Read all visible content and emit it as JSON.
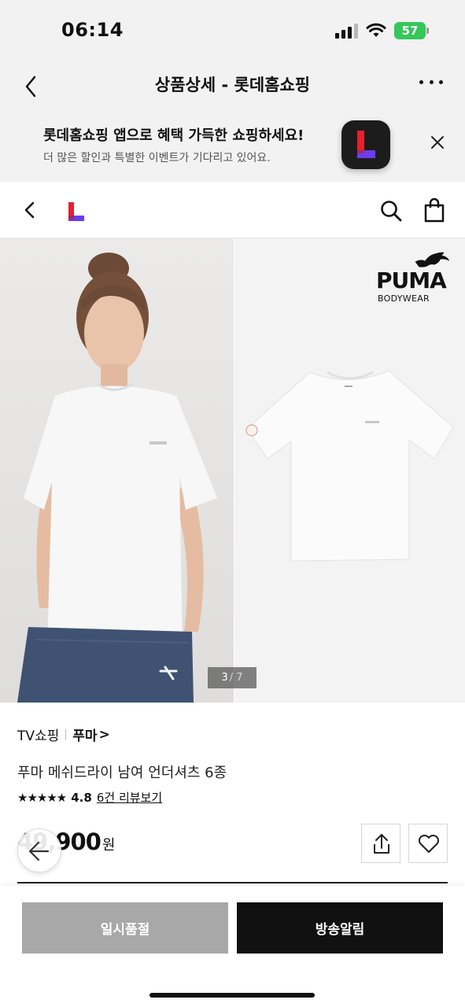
{
  "status_bar": {
    "time": "06:14",
    "battery": "57"
  },
  "browser": {
    "title": "상품상세 - 롯데홈쇼핑"
  },
  "banner": {
    "title": "롯데홈쇼핑 앱으로 혜택 가득한 쇼핑하세요!",
    "subtitle": "더 많은 할인과 특별한 이벤트가 기다리고 있어요."
  },
  "gallery": {
    "brand_logo_text": "PUMA",
    "brand_logo_sub": "BODYWEAR",
    "current": "3",
    "total": "/ 7"
  },
  "product": {
    "category": "TV쇼핑",
    "brand": "푸마",
    "brand_chevron": ">",
    "name": "푸마 메쉬드라이 남여 언더셔츠 6종",
    "stars": "★★★★★",
    "rating": "4.8",
    "review_link": "6건 리뷰보기",
    "price": "49,900",
    "currency": "원"
  },
  "actions": {
    "soldout_label": "일시품절",
    "alarm_label": "방송알림"
  },
  "colors": {
    "brand_red": "#e6202e",
    "brand_purple": "#6b3cf0",
    "battery_green": "#34c759"
  }
}
